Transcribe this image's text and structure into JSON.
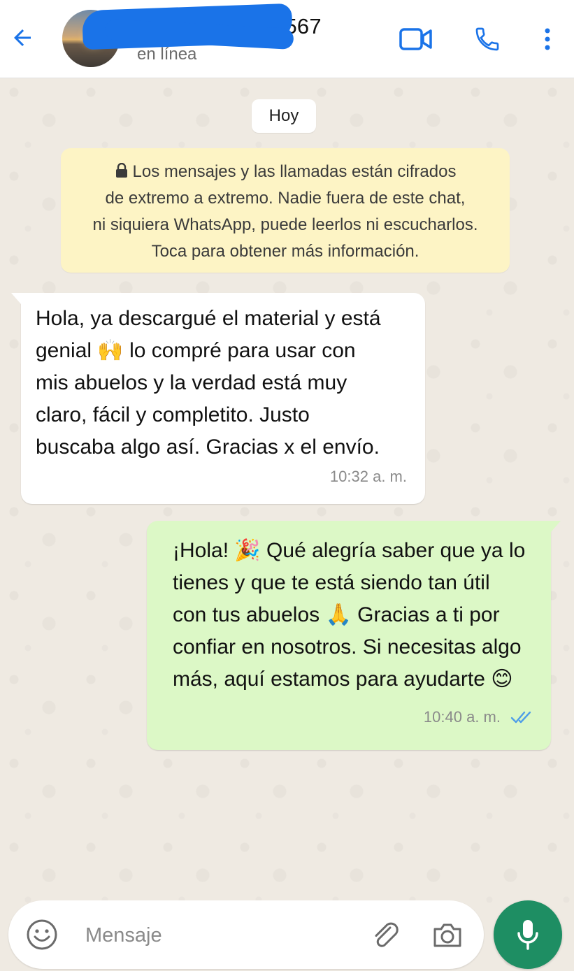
{
  "header": {
    "contact_name": "4567",
    "status": "en línea"
  },
  "chat": {
    "day_label": "Hoy",
    "encryption_notice": {
      "lines": [
        "Los mensajes y las llamadas están cifrados",
        "de extremo a extremo. Nadie fuera de este chat,",
        "ni siquiera WhatsApp, puede leerlos ni escucharlos.",
        "Toca para obtener más información."
      ]
    },
    "messages": [
      {
        "direction": "incoming",
        "lines": [
          "Hola, ya descargué el material y está",
          "genial 🙌  lo compré para usar con",
          "mis abuelos y la verdad está muy",
          "claro, fácil y completito. Justo",
          "buscaba algo así. Gracias x el envío."
        ],
        "time": "10:32 a. m."
      },
      {
        "direction": "outgoing",
        "lines": [
          "¡Hola! 🎉 Qué alegría saber que ya lo",
          "tienes y que te está siendo tan útil",
          "con tus abuelos 🙏 Gracias a ti por",
          "confiar en nosotros. Si necesitas algo",
          "más, aquí estamos para ayudarte 😊"
        ],
        "time": "10:40 a. m.",
        "read_status": "read"
      }
    ]
  },
  "composer": {
    "placeholder": "Mensaje",
    "value": ""
  },
  "colors": {
    "accent": "#1a73e8",
    "outgoing_bubble": "#dcf8c6",
    "incoming_bubble": "#ffffff",
    "notice_bg": "#fdf4c5",
    "mic_button": "#1e8e63",
    "read_ticks": "#4f9ee8"
  },
  "icons": [
    "back-arrow-icon",
    "video-call-icon",
    "phone-icon",
    "more-vertical-icon",
    "lock-icon",
    "read-ticks-icon",
    "emoji-icon",
    "attach-icon",
    "camera-icon",
    "mic-icon"
  ]
}
